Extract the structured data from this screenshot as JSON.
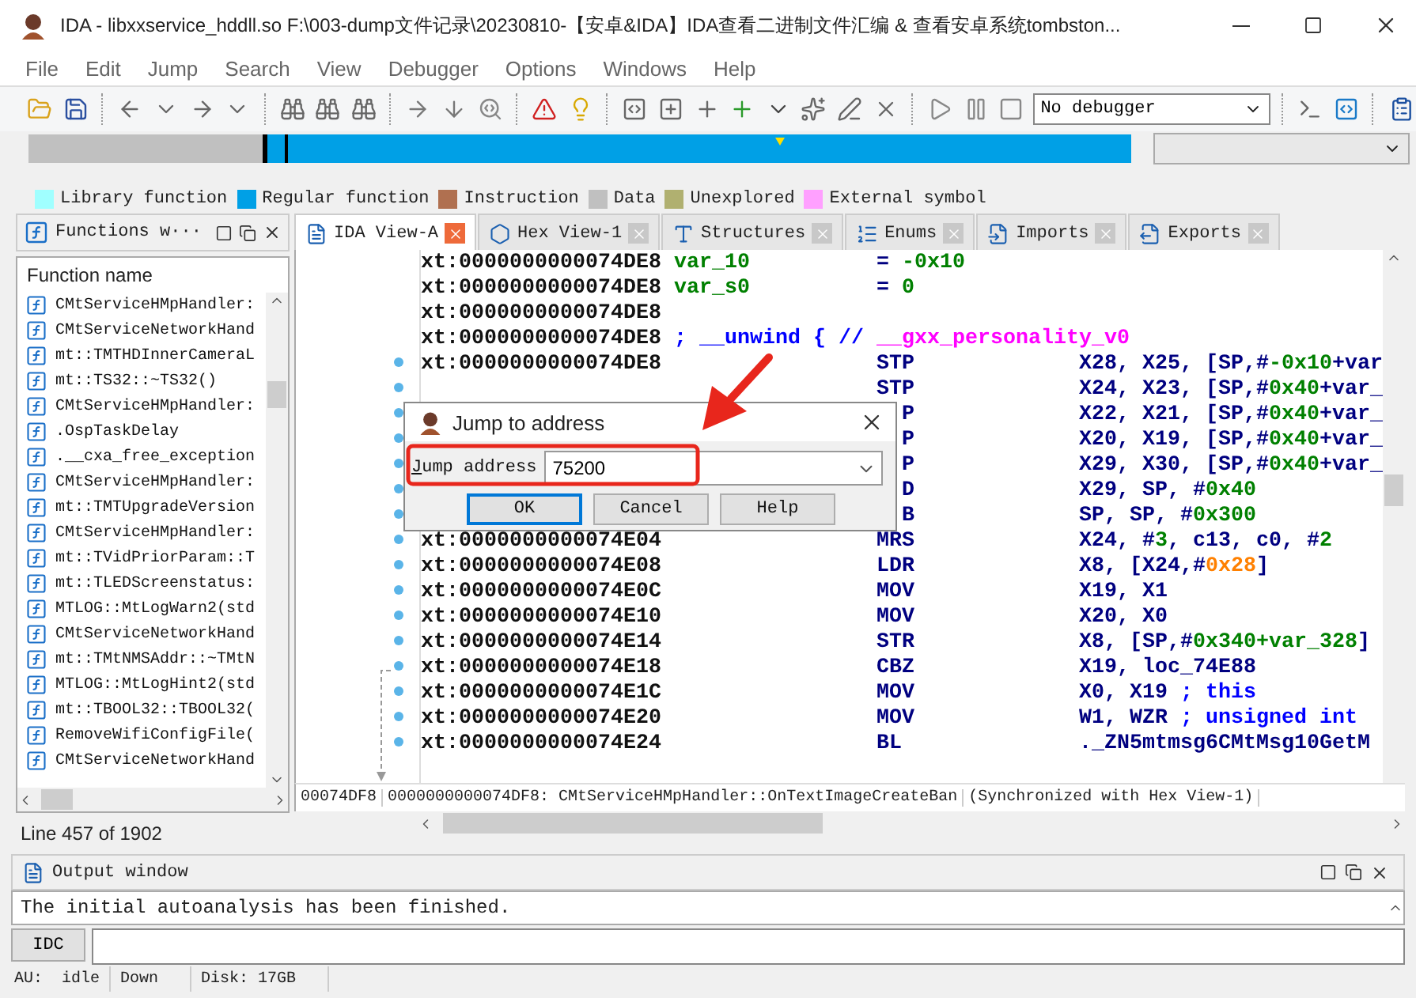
{
  "window": {
    "title": "IDA - libxxservice_hddll.so F:\\003-dump文件记录\\20230810-【安卓&IDA】IDA查看二进制文件汇编 & 查看安卓系统tombston..."
  },
  "menu": [
    "File",
    "Edit",
    "Jump",
    "Search",
    "View",
    "Debugger",
    "Options",
    "Windows",
    "Help"
  ],
  "toolbar": {
    "debugger": "No debugger"
  },
  "legend": [
    {
      "label": "Library function",
      "color": "#a0ffff"
    },
    {
      "label": "Regular function",
      "color": "#00a0e6"
    },
    {
      "label": "Instruction",
      "color": "#b07050"
    },
    {
      "label": "Data",
      "color": "#c0c0c0"
    },
    {
      "label": "Unexplored",
      "color": "#b0b070"
    },
    {
      "label": "External symbol",
      "color": "#ffa0ff"
    }
  ],
  "functions_panel": {
    "tab": "Functions w···",
    "column": "Function name",
    "items": [
      "CMtServiceHMpHandler:",
      "CMtServiceNetworkHand",
      "mt::TMTHDInnerCameraL",
      "mt::TS32::~TS32()",
      "CMtServiceHMpHandler:",
      ".OspTaskDelay",
      ".__cxa_free_exception",
      "CMtServiceHMpHandler:",
      "mt::TMTUpgradeVersion",
      "CMtServiceHMpHandler:",
      "mt::TVidPriorParam::T",
      "mt::TLEDScreenstatus:",
      "MTLOG::MtLogWarn2(std",
      "CMtServiceNetworkHand",
      "mt::TMtNMSAddr::~TMtN",
      "MTLOG::MtLogHint2(std",
      "mt::TBOOL32::TBOOL32(",
      "RemoveWifiConfigFile(",
      "CMtServiceNetworkHand"
    ],
    "status": "Line 457 of 1902"
  },
  "tabs": [
    {
      "label": "IDA View-A",
      "selected": true,
      "kind": "listing"
    },
    {
      "label": "Hex View-1",
      "selected": false,
      "kind": "hex"
    },
    {
      "label": "Structures",
      "selected": false,
      "kind": "structures"
    },
    {
      "label": "Enums",
      "selected": false,
      "kind": "enums"
    },
    {
      "label": "Imports",
      "selected": false,
      "kind": "imports"
    },
    {
      "label": "Exports",
      "selected": false,
      "kind": "exports"
    }
  ],
  "disassembly": {
    "rows": [
      {
        "kind": "decl",
        "address": "xt:0000000000074DE8",
        "name": "var_10",
        "operands": [
          {
            "text": "=",
            "color": "#000080"
          },
          {
            "text": "-0x10",
            "color": "#008000"
          }
        ]
      },
      {
        "kind": "decl",
        "address": "xt:0000000000074DE8",
        "name": "var_s0",
        "operands": [
          {
            "text": "=",
            "color": "#000080"
          },
          {
            "text": "0",
            "color": "#008000"
          }
        ]
      },
      {
        "kind": "blank",
        "address": "xt:0000000000074DE8"
      },
      {
        "kind": "comment",
        "address": "xt:0000000000074DE8",
        "operands": [
          {
            "text": "; __unwind { // ",
            "color": "#0000ff"
          },
          {
            "text": "__gxx_personality_v0",
            "color": "#ff00ff"
          }
        ]
      },
      {
        "kind": "insn",
        "address": "xt:0000000000074DE8",
        "mnemonic": "STP",
        "operands": [
          {
            "text": "X28, X25, [SP,#",
            "color": "#000080"
          },
          {
            "text": "-0x10",
            "color": "#008000"
          },
          {
            "text": "+var",
            "color": "#000080"
          }
        ]
      },
      {
        "kind": "partial",
        "mnemonic": "STP",
        "operands": [
          {
            "text": "X24, X23, [SP,#",
            "color": "#000080"
          },
          {
            "text": "0x40",
            "color": "#008000"
          },
          {
            "text": "+var_",
            "color": "#000080"
          }
        ]
      },
      {
        "kind": "partial",
        "mnemonic": "P",
        "operands": [
          {
            "text": "X22, X21, [SP,#",
            "color": "#000080"
          },
          {
            "text": "0x40",
            "color": "#008000"
          },
          {
            "text": "+var_",
            "color": "#000080"
          }
        ]
      },
      {
        "kind": "partial",
        "mnemonic": "P",
        "operands": [
          {
            "text": "X20, X19, [SP,#",
            "color": "#000080"
          },
          {
            "text": "0x40",
            "color": "#008000"
          },
          {
            "text": "+var_",
            "color": "#000080"
          }
        ]
      },
      {
        "kind": "partial",
        "mnemonic": "P",
        "operands": [
          {
            "text": "X29, X30, [SP,#",
            "color": "#000080"
          },
          {
            "text": "0x40",
            "color": "#008000"
          },
          {
            "text": "+var_",
            "color": "#000080"
          }
        ]
      },
      {
        "kind": "partial",
        "mnemonic": "D",
        "operands": [
          {
            "text": "X29, SP, #",
            "color": "#000080"
          },
          {
            "text": "0x40",
            "color": "#008000"
          }
        ]
      },
      {
        "kind": "partial",
        "mnemonic": "B",
        "operands": [
          {
            "text": "SP, SP, #",
            "color": "#000080"
          },
          {
            "text": "0x300",
            "color": "#008000"
          }
        ]
      },
      {
        "kind": "insn",
        "address": "xt:0000000000074E04",
        "mnemonic": "MRS",
        "operands": [
          {
            "text": "X24, #",
            "color": "#000080"
          },
          {
            "text": "3",
            "color": "#008000"
          },
          {
            "text": ", c13, c0, #",
            "color": "#000080"
          },
          {
            "text": "2",
            "color": "#008000"
          }
        ]
      },
      {
        "kind": "insn",
        "address": "xt:0000000000074E08",
        "mnemonic": "LDR",
        "operands": [
          {
            "text": "X8, [X24,#",
            "color": "#000080"
          },
          {
            "text": "0x28",
            "color": "#ff8000"
          },
          {
            "text": "]",
            "color": "#000080"
          }
        ]
      },
      {
        "kind": "insn",
        "address": "xt:0000000000074E0C",
        "mnemonic": "MOV",
        "operands": [
          {
            "text": "X19, X1",
            "color": "#000080"
          }
        ]
      },
      {
        "kind": "insn",
        "address": "xt:0000000000074E10",
        "mnemonic": "MOV",
        "operands": [
          {
            "text": "X20, X0",
            "color": "#000080"
          }
        ]
      },
      {
        "kind": "insn",
        "address": "xt:0000000000074E14",
        "mnemonic": "STR",
        "operands": [
          {
            "text": "X8, [SP,#",
            "color": "#000080"
          },
          {
            "text": "0x340+var_328",
            "color": "#008000"
          },
          {
            "text": "]",
            "color": "#000080"
          }
        ]
      },
      {
        "kind": "insn",
        "address": "xt:0000000000074E18",
        "mnemonic": "CBZ",
        "operands": [
          {
            "text": "X19, loc_74E88",
            "color": "#000080"
          }
        ]
      },
      {
        "kind": "insn",
        "address": "xt:0000000000074E1C",
        "mnemonic": "MOV",
        "operands": [
          {
            "text": "X0, X19 ",
            "color": "#000080"
          },
          {
            "text": "; this",
            "color": "#0000ff"
          }
        ]
      },
      {
        "kind": "insn",
        "address": "xt:0000000000074E20",
        "mnemonic": "MOV",
        "operands": [
          {
            "text": "W1, WZR ",
            "color": "#000080"
          },
          {
            "text": "; unsigned int",
            "color": "#0000ff"
          }
        ]
      },
      {
        "kind": "insn",
        "address": "xt:0000000000074E24",
        "mnemonic": "BL",
        "operands": [
          {
            "text": "._ZN5mtmsg6CMtMsg10GetM",
            "color": "#000080"
          }
        ]
      }
    ],
    "status": [
      "00074DF8",
      "0000000000074DF8: CMtServiceHMpHandler::OnTextImageCreateBan",
      "(Synchronized with Hex View-1)"
    ]
  },
  "dialog": {
    "title": "Jump to address",
    "label": "Jump address",
    "value": "75200",
    "buttons": [
      {
        "label": "OK",
        "default": true
      },
      {
        "label": "Cancel",
        "default": false
      },
      {
        "label": "Help",
        "default": false
      }
    ]
  },
  "output": {
    "title": "Output window",
    "text": "The initial autoanalysis has been finished.",
    "button": "IDC",
    "status": [
      "AU:",
      "idle",
      "Down",
      "Disk: 17GB"
    ]
  }
}
